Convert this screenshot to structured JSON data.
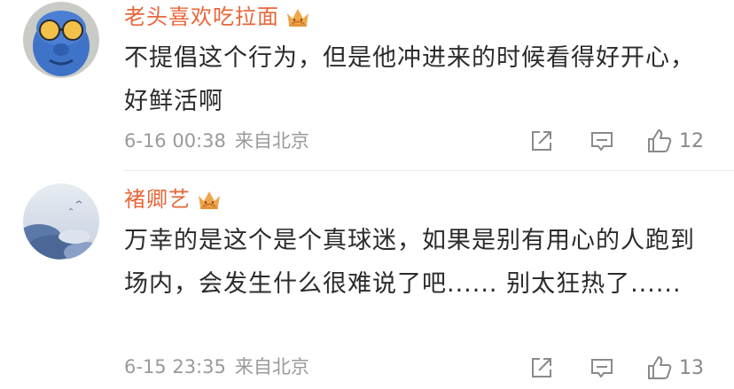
{
  "comments": [
    {
      "username": "老头喜欢吃拉面",
      "text": "不提倡这个行为，但是他冲进来的时候看得好开心，好鲜活啊",
      "time": "6-16 00:38",
      "location": "来自北京",
      "likes": "12"
    },
    {
      "username": "褚卿艺",
      "text": "万幸的是这个是个真球迷，如果是别有用心的人跑到场内，会发生什么很难说了吧...... 别太狂热了......",
      "time": "6-15 23:35",
      "location": "来自北京",
      "likes": "13"
    }
  ],
  "colors": {
    "username": "#e8663a",
    "text": "#2b2b2b",
    "meta": "#9a9a9a",
    "crown": "#f0a64a"
  },
  "icons": {
    "badge": "crown-icon",
    "share": "share-icon",
    "reply": "comment-icon",
    "like": "thumbs-up-icon"
  }
}
